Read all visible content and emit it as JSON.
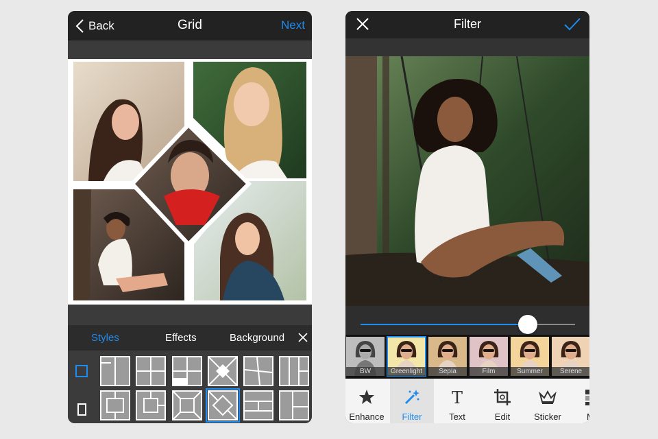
{
  "grid_screen": {
    "header": {
      "back_label": "Back",
      "title": "Grid",
      "next_label": "Next"
    },
    "tabs": [
      {
        "label": "Styles",
        "active": true
      },
      {
        "label": "Effects",
        "active": false
      },
      {
        "label": "Background",
        "active": false
      }
    ],
    "aspect_options": [
      "square-icon",
      "portrait-icon"
    ],
    "templates_row1": [
      "two-vertical",
      "four-squares",
      "offset-four",
      "diamond-corner",
      "angled-grid",
      "three-columns"
    ],
    "templates_row2": [
      "center-rect",
      "nested-squares",
      "frame-diagonals",
      "center-diamond",
      "stacked-rows",
      "split-columns"
    ],
    "selected_template": "center-diamond",
    "collage_layout": "four corners with center diamond"
  },
  "filter_screen": {
    "header": {
      "title": "Filter"
    },
    "intensity": 0.78,
    "filters": [
      {
        "label": "BW",
        "selected": false
      },
      {
        "label": "Greenlight",
        "selected": true
      },
      {
        "label": "Sepia",
        "selected": false
      },
      {
        "label": "Film",
        "selected": false
      },
      {
        "label": "Summer",
        "selected": false
      },
      {
        "label": "Serene",
        "selected": false
      }
    ],
    "tools": [
      {
        "label": "Enhance",
        "icon": "star-icon",
        "selected": false
      },
      {
        "label": "Filter",
        "icon": "magic-wand-icon",
        "selected": true
      },
      {
        "label": "Text",
        "icon": "text-icon",
        "selected": false
      },
      {
        "label": "Edit",
        "icon": "crop-icon",
        "selected": false
      },
      {
        "label": "Sticker",
        "icon": "crown-icon",
        "selected": false
      },
      {
        "label": "Mo",
        "icon": "mosaic-icon",
        "selected": false
      }
    ]
  },
  "colors": {
    "accent": "#1e8cf0",
    "topbar": "#222222",
    "panel": "#3b3b3b"
  }
}
